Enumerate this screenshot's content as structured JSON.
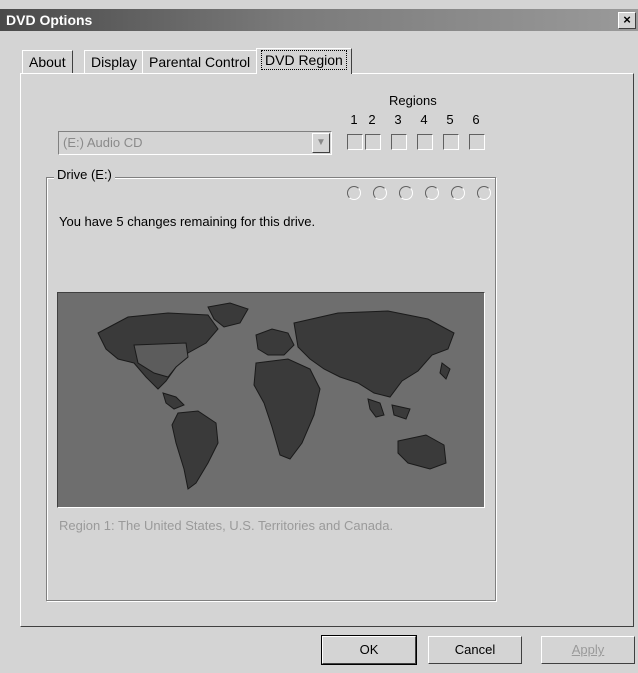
{
  "window": {
    "title": "DVD Options",
    "close_label": "×"
  },
  "tabs": [
    {
      "label": "About"
    },
    {
      "label": "Display"
    },
    {
      "label": "Parental Control"
    },
    {
      "label": "DVD Region",
      "active": true
    }
  ],
  "drive_select": {
    "value": "(E:) Audio CD",
    "arrow": "▼"
  },
  "regions": {
    "label": "Regions",
    "numbers": [
      "1",
      "2",
      "3",
      "4",
      "5",
      "6"
    ]
  },
  "drive_group": {
    "label": "Drive (E:)",
    "changes_text": "You have 5 changes remaining for this drive."
  },
  "region_description": "Region 1: The United States, U.S. Territories and Canada.",
  "buttons": {
    "ok": "OK",
    "cancel": "Cancel",
    "apply": "Apply"
  },
  "colors": {
    "map_background": "#6e6e6e",
    "land": "#3a3a3a",
    "highlight_region": "#5c5c5c"
  }
}
